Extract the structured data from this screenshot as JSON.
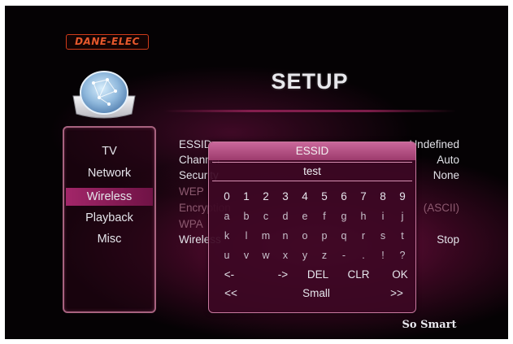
{
  "brand": {
    "logo_text": "DANE-ELEC",
    "tagline": "So Smart"
  },
  "page": {
    "title": "SETUP"
  },
  "sidebar": {
    "items": [
      {
        "label": "TV"
      },
      {
        "label": "Network"
      },
      {
        "label": "Wireless",
        "selected": true
      },
      {
        "label": "Playback"
      },
      {
        "label": "Misc"
      }
    ]
  },
  "settings": {
    "rows": [
      {
        "label": "ESSID",
        "value": "Undefined"
      },
      {
        "label": "Channel",
        "value": "Auto"
      },
      {
        "label": "Security",
        "value": "None"
      },
      {
        "label": "WEP",
        "value": ""
      },
      {
        "label": "Encryption",
        "value": "(ASCII)"
      },
      {
        "label": "WPA",
        "value": ""
      },
      {
        "label": "Wireless",
        "value": "Stop"
      }
    ]
  },
  "keyboard": {
    "title": "ESSID",
    "input_value": "test",
    "rows": [
      [
        "0",
        "1",
        "2",
        "3",
        "4",
        "5",
        "6",
        "7",
        "8",
        "9"
      ],
      [
        "a",
        "b",
        "c",
        "d",
        "e",
        "f",
        "g",
        "h",
        "i",
        "j"
      ],
      [
        "k",
        "l",
        "m",
        "n",
        "o",
        "p",
        "q",
        "r",
        "s",
        "t"
      ],
      [
        "u",
        "v",
        "w",
        "x",
        "y",
        "z",
        "-",
        ".",
        "!",
        "?"
      ]
    ],
    "keys": {
      "back": "<-",
      "forward": "->",
      "delete": "DEL",
      "clear": "CLR",
      "ok": "OK",
      "prev_page": "<<",
      "case_mode": "Small",
      "next_page": ">>"
    }
  },
  "colors": {
    "background": "#050204",
    "accent": "#a7306c",
    "selected_item": "#aa286e",
    "logo": "#e6582c"
  }
}
